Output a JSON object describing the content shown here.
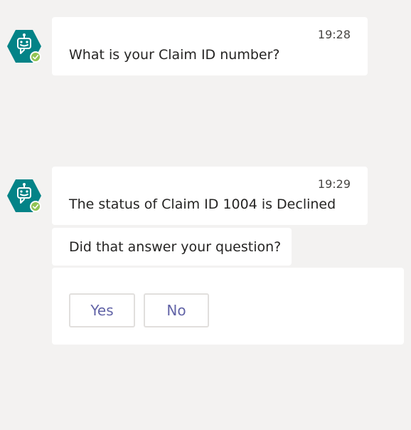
{
  "messages": [
    {
      "time": "19:28",
      "text": "What is your Claim ID number?"
    },
    {
      "time": "19:29",
      "text": "The status of Claim ID 1004 is Declined"
    }
  ],
  "followup": {
    "text": "Did that answer your question?"
  },
  "card": {
    "yes_label": "Yes",
    "no_label": "No"
  },
  "colors": {
    "avatar_bg": "#038387",
    "presence": "#92c353",
    "button_text": "#6264a7",
    "background": "#f3f2f1"
  },
  "icons": {
    "avatar": "bot-icon",
    "presence": "available-checkmark-icon"
  }
}
